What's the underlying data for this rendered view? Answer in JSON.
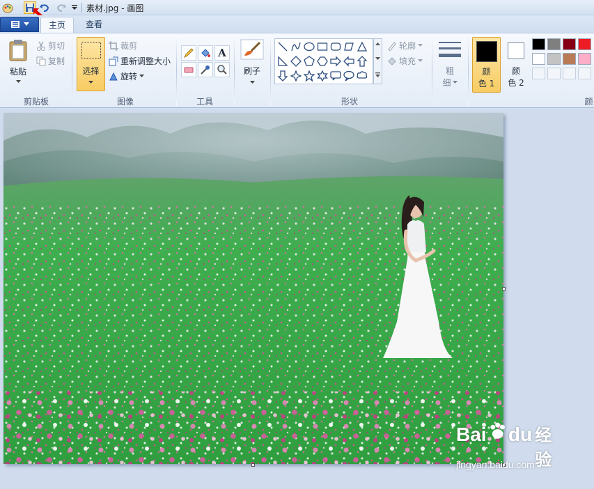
{
  "title": "素材.jpg - 画图",
  "tabs": {
    "home": "主页",
    "view": "查看"
  },
  "clipboard": {
    "paste": "粘贴",
    "cut": "剪切",
    "copy": "复制",
    "group": "剪贴板"
  },
  "image_group": {
    "select": "选择",
    "crop": "裁剪",
    "resize": "重新调整大小",
    "rotate": "旋转",
    "group": "图像"
  },
  "tools": {
    "group": "工具",
    "text_glyph": "A"
  },
  "brush": {
    "label": "刷子"
  },
  "shapes": {
    "outline": "轮廓",
    "fill": "填充",
    "group": "形状"
  },
  "size": {
    "label_line1": "粗",
    "label_line2": "细"
  },
  "colors": {
    "color1_line1": "颜",
    "color1_line2": "色 1",
    "color2_line1": "颜",
    "color2_line2": "色 2",
    "group_partial": "颜",
    "color1_value": "#000000",
    "color2_value": "#ffffff",
    "palette_row1": [
      "#000000",
      "#7f7f7f",
      "#880015",
      "#ed1c24"
    ],
    "palette_row2": [
      "#ffffff",
      "#c3c3c3",
      "#b97a57",
      "#ffaec9"
    ]
  },
  "watermark": {
    "brand": "Bai",
    "brand2": "du",
    "suffix": "经验",
    "url": "jingyan.baidu.com"
  }
}
